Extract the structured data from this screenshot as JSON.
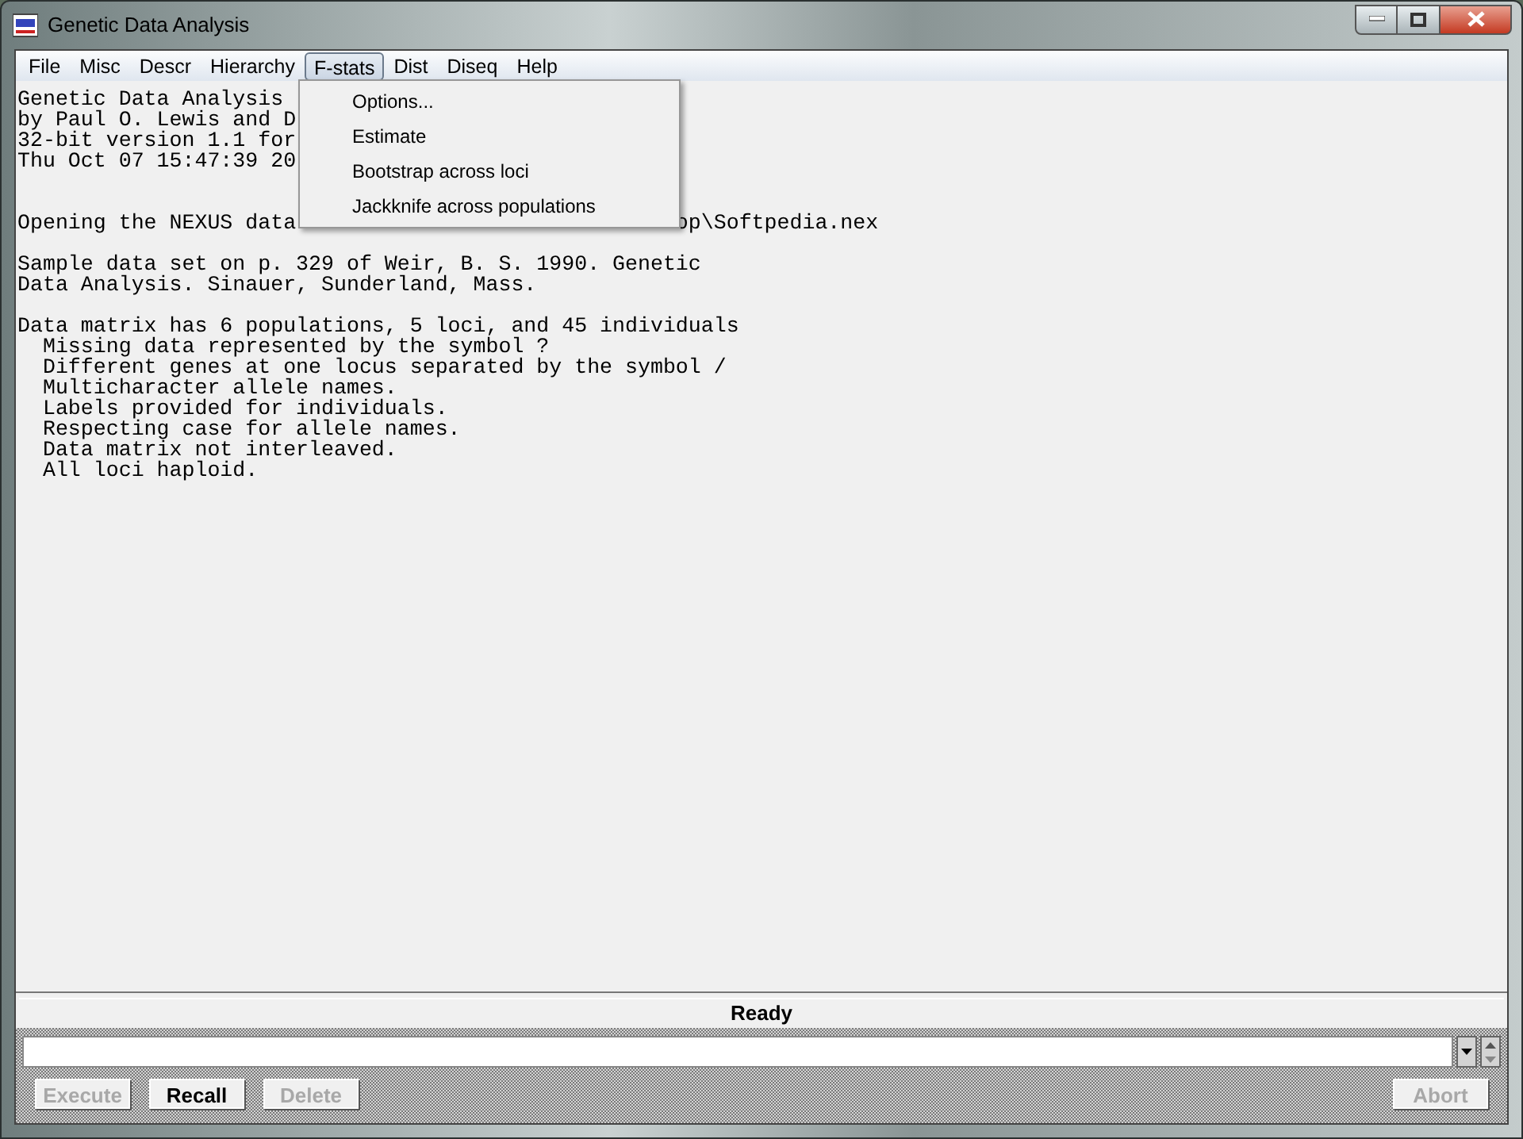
{
  "window": {
    "title": "Genetic Data Analysis"
  },
  "menu_bar": [
    {
      "label": "File",
      "selected": false
    },
    {
      "label": "Misc",
      "selected": false
    },
    {
      "label": "Descr",
      "selected": false
    },
    {
      "label": "Hierarchy",
      "selected": false
    },
    {
      "label": "F-stats",
      "selected": true
    },
    {
      "label": "Dist",
      "selected": false
    },
    {
      "label": "Diseq",
      "selected": false
    },
    {
      "label": "Help",
      "selected": false
    }
  ],
  "open_menu": {
    "items": [
      "Options...",
      "Estimate",
      "Bootstrap across loci",
      "Jackknife across populations"
    ]
  },
  "output": {
    "paragraphs": [
      {
        "lines": [
          [
            "Genetic Data Analysis"
          ],
          [
            "by Paul O. Lewis and D"
          ],
          [
            "32-bit version 1.1 for"
          ],
          [
            "Thu Oct 07 15:47:39 20"
          ]
        ]
      },
      {
        "lines": [
          [
            "Opening the NEXUS data",
            "op\\Softpedia.nex"
          ]
        ]
      },
      {
        "lines": [
          [
            "Sample data set on p. 329 of Weir, B. S. 1990. Genetic"
          ],
          [
            "Data Analysis. Sinauer, Sunderland, Mass."
          ]
        ]
      },
      {
        "lines": [
          [
            "Data matrix has 6 populations, 5 loci, and 45 individuals"
          ],
          [
            "  Missing data represented by the symbol ?"
          ],
          [
            "  Different genes at one locus separated by the symbol /"
          ],
          [
            "  Multicharacter allele names."
          ],
          [
            "  Labels provided for individuals."
          ],
          [
            "  Respecting case for allele names."
          ],
          [
            "  Data matrix not interleaved."
          ],
          [
            "  All loci haploid."
          ]
        ]
      }
    ]
  },
  "status_bar": "Ready",
  "buttons": [
    {
      "label": "Execute",
      "disabled": true
    },
    {
      "label": "Recall",
      "disabled": false
    },
    {
      "label": "Delete",
      "disabled": true
    },
    {
      "label": "Abort",
      "disabled": true
    }
  ]
}
